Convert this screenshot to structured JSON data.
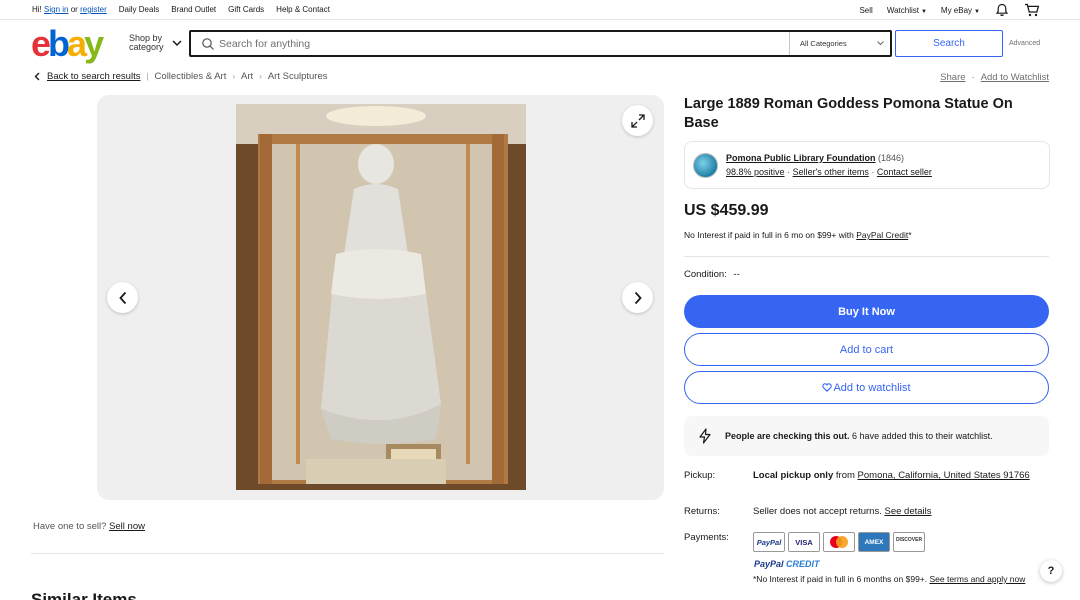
{
  "topnav": {
    "hi": "Hi!",
    "sign_in": "Sign in",
    "or": "or",
    "register": "register",
    "links": [
      "Daily Deals",
      "Brand Outlet",
      "Gift Cards",
      "Help & Contact"
    ],
    "sell": "Sell",
    "watchlist": "Watchlist",
    "my_ebay": "My eBay"
  },
  "header": {
    "logo": {
      "e": "e",
      "b": "b",
      "a": "a",
      "y": "y"
    },
    "shop_by_1": "Shop by",
    "shop_by_2": "category",
    "search_placeholder": "Search for anything",
    "category": "All Categories",
    "search_button": "Search",
    "advanced": "Advanced"
  },
  "breadcrumb": {
    "back": "Back to search results",
    "items": [
      "Collectibles & Art",
      "Art",
      "Art Sculptures"
    ],
    "share": "Share",
    "add_watchlist": "Add to Watchlist"
  },
  "sell_prompt": {
    "text": "Have one to sell?",
    "link": "Sell now"
  },
  "similar_heading": "Similar Items",
  "item": {
    "title": "Large 1889 Roman Goddess Pomona Statue On Base",
    "seller": {
      "name": "Pomona Public Library Foundation",
      "count": "(1846)",
      "positive": "98.8% positive",
      "other_items": "Seller's other items",
      "contact": "Contact seller"
    },
    "price": "US $459.99",
    "financing": {
      "text": "No Interest if paid in full in 6 mo on $99+ with",
      "link": "PayPal Credit",
      "mark": "*"
    },
    "condition_label": "Condition:",
    "condition_value": "--",
    "buy_now": "Buy It Now",
    "add_cart": "Add to cart",
    "add_watchlist": "Add to watchlist",
    "alert": {
      "bold": "People are checking this out.",
      "rest": " 6 have added this to their watchlist."
    },
    "pickup": {
      "label": "Pickup:",
      "bold": "Local pickup only",
      "from": " from ",
      "location": "Pomona, California, United States 91766"
    },
    "returns": {
      "label": "Returns:",
      "text": "Seller does not accept returns. ",
      "link": "See details"
    },
    "payments": {
      "label": "Payments:",
      "cards": [
        "PayPal",
        "VISA",
        "",
        "AMEX",
        "DISCOVER"
      ],
      "credit_a": "PayPal",
      "credit_b": "CREDIT",
      "note": "*No Interest if paid in full in 6 months on $99+. ",
      "note_link": "See terms and apply now"
    }
  },
  "help": "?",
  "colors": {
    "brand_blue": "#3665f3",
    "logo_red": "#e53238",
    "logo_blue": "#0064d2",
    "logo_yellow": "#f5af02",
    "logo_green": "#86b817"
  }
}
